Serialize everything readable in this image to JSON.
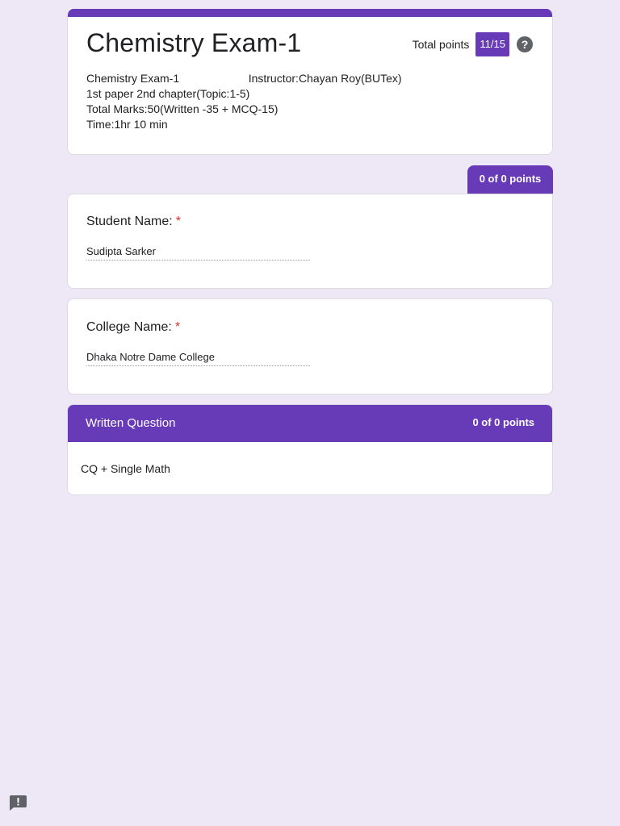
{
  "form": {
    "title": "Chemistry Exam-1",
    "total_points_label": "Total points",
    "score": "11/15",
    "help_symbol": "?",
    "description": [
      "Chemistry Exam-1                      Instructor:Chayan Roy(BUTex)",
      "1st paper 2nd chapter(Topic:1-5)",
      "Total Marks:50(Written -35 + MCQ-15)",
      "Time:1hr 10 min"
    ]
  },
  "section_points": "0 of 0 points",
  "questions": [
    {
      "title": "Student Name:",
      "required_mark": "*",
      "answer": "Sudipta Sarker"
    },
    {
      "title": "College Name:",
      "required_mark": "*",
      "answer": "Dhaka Notre Dame College"
    }
  ],
  "section": {
    "title": "Written Question",
    "points": "0 of 0 points",
    "description": "CQ + Single Math"
  },
  "icons": {
    "help": "help-circle-icon",
    "feedback": "report-feedback-icon"
  },
  "colors": {
    "accent": "#673ab7",
    "background": "#ede7f6",
    "required": "#d93025"
  }
}
